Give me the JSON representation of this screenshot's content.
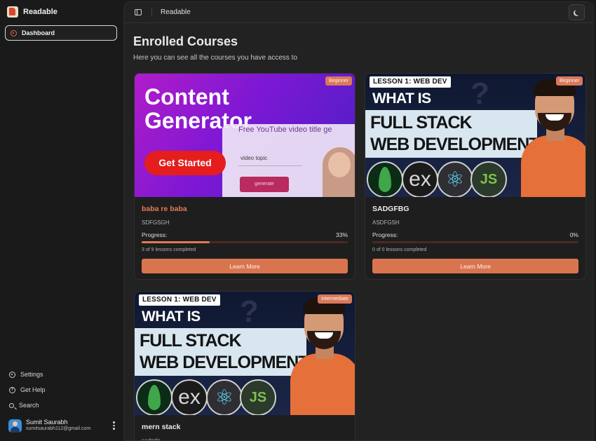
{
  "app": {
    "name": "Readable"
  },
  "sidebar": {
    "nav": [
      {
        "label": "Dashboard",
        "active": true
      }
    ],
    "bottom": [
      {
        "label": "Settings",
        "icon": "gear-icon"
      },
      {
        "label": "Get Help",
        "icon": "help-icon"
      },
      {
        "label": "Search",
        "icon": "search-icon"
      }
    ],
    "user": {
      "name": "Sumit Saurabh",
      "email": "sumitsaurabh112@gmail.com"
    }
  },
  "topbar": {
    "title": "Readable"
  },
  "page": {
    "title": "Enrolled Courses",
    "subtitle": "Here you can see all the courses you have access to"
  },
  "courses": [
    {
      "level": "Beginner",
      "title": "baba re baba",
      "code": "SDFGSGH",
      "progress_label": "Progress:",
      "progress_text": "33%",
      "progress": 0.33,
      "lessons_text": "3 of 9 lessons completed",
      "button": "Learn More",
      "thumb": {
        "line1": "Content",
        "line2": "Generator",
        "panel_title": "Free YouTube video title ge",
        "input_text": "video topic",
        "gen_button": "generate",
        "cta": "Get Started"
      }
    },
    {
      "level": "Beginner",
      "title": "SADGFBG",
      "code": "ASDFGSH",
      "progress_label": "Progress:",
      "progress_text": "0%",
      "progress": 0,
      "lessons_text": "0 of 0 lessons completed",
      "button": "Learn More",
      "thumb": {
        "lesson": "LESSON 1: WEB DEV",
        "q": "?",
        "line1": "WHAT IS",
        "line2": "FULL STACK",
        "line3": "WEB DEVELOPMENT?",
        "ex": "ex",
        "react": "⚛",
        "node": "JS"
      }
    },
    {
      "level": "Intermediate",
      "title": "mern stack",
      "code": "sadgdg",
      "thumb": {
        "lesson": "LESSON 1: WEB DEV",
        "q": "?",
        "line1": "WHAT IS",
        "line2": "FULL STACK",
        "line3": "WEB DEVELOPMENT?",
        "ex": "ex",
        "react": "⚛",
        "node": "JS"
      }
    }
  ],
  "colors": {
    "accent": "#d8754f",
    "background": "#1a1a1a",
    "panel": "#222222"
  }
}
